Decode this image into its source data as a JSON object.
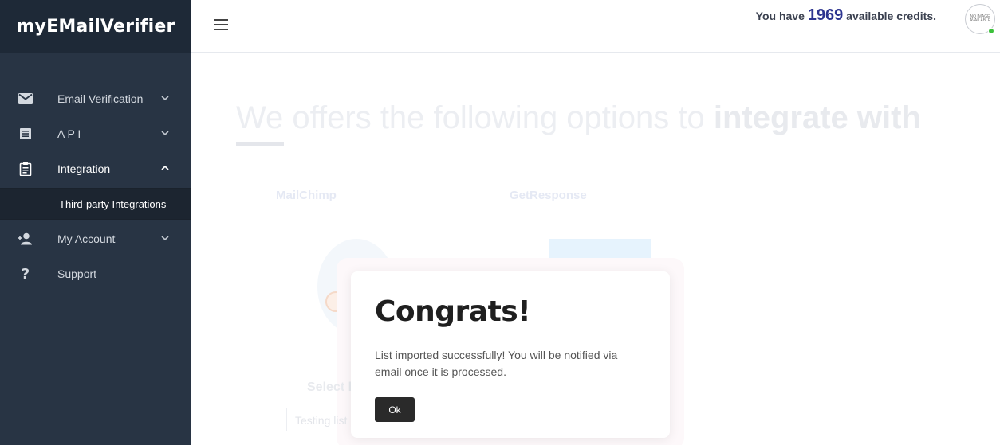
{
  "brand": {
    "name": "myEMailVerifier"
  },
  "sidebar": {
    "items": [
      {
        "label": "Email Verification",
        "icon": "envelope-icon",
        "expanded": false
      },
      {
        "label": "A P I",
        "icon": "document-icon",
        "expanded": false
      },
      {
        "label": "Integration",
        "icon": "clipboard-icon",
        "expanded": true
      },
      {
        "label": "My Account",
        "icon": "add-user-icon",
        "expanded": false
      },
      {
        "label": "Support",
        "icon": "question-icon"
      }
    ],
    "subitems": [
      {
        "label": "Third-party Integrations"
      }
    ]
  },
  "topbar": {
    "credits_prefix": "You have",
    "credits_value": "1969",
    "credits_suffix": "available credits.",
    "avatar_text": "NO IMAGE AVAILABLE"
  },
  "page": {
    "headline_regular": "We offers the following options to ",
    "headline_bold": "integrate with",
    "tabs": [
      "MailChimp",
      "GetResponse"
    ],
    "select_label": "Select l",
    "select_value": "Testing list"
  },
  "modal": {
    "title": "Congrats!",
    "message": "List imported successfully! You will be notified via email once it is processed.",
    "ok_label": "Ok"
  },
  "colors": {
    "sidebar_bg": "#283444",
    "brand_bg": "#1e2937",
    "credits_accent": "#2d3590",
    "online_status": "#3cc13b"
  }
}
